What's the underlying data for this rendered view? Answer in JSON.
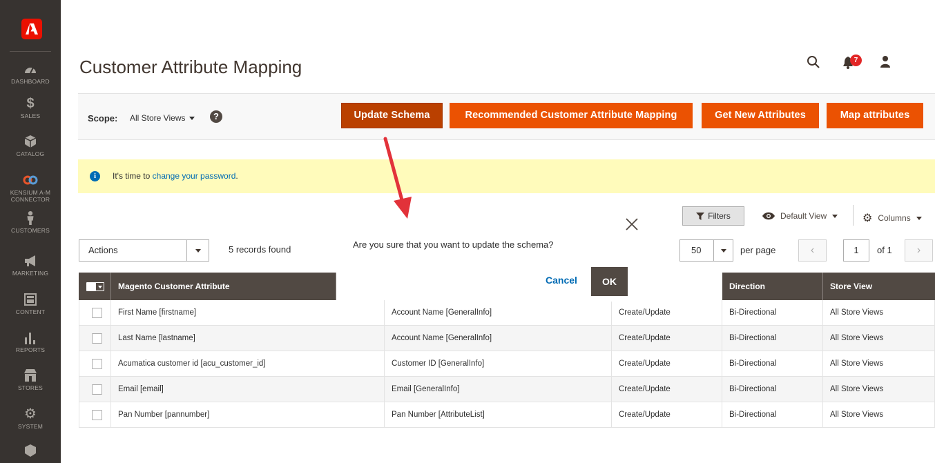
{
  "sidebar": {
    "items": [
      {
        "label": "DASHBOARD",
        "icon": "dashboard-icon"
      },
      {
        "label": "SALES",
        "icon": "dollar-icon"
      },
      {
        "label": "CATALOG",
        "icon": "box-icon"
      },
      {
        "label": "KENSIUM A-M CONNECTOR",
        "icon": "infinity-icon"
      },
      {
        "label": "CUSTOMERS",
        "icon": "person-icon"
      },
      {
        "label": "MARKETING",
        "icon": "megaphone-icon"
      },
      {
        "label": "CONTENT",
        "icon": "layout-icon"
      },
      {
        "label": "REPORTS",
        "icon": "bar-chart-icon"
      },
      {
        "label": "STORES",
        "icon": "store-icon"
      },
      {
        "label": "SYSTEM",
        "icon": "gear-icon"
      }
    ]
  },
  "header": {
    "title": "Customer Attribute Mapping",
    "notifications_count": "7"
  },
  "action_bar": {
    "scope_label": "Scope:",
    "scope_value": "All Store Views",
    "help_glyph": "?",
    "buttons": {
      "update_schema": "Update Schema",
      "recommended": "Recommended Customer Attribute Mapping",
      "get_new": "Get New Attributes",
      "map": "Map attributes"
    }
  },
  "notice": {
    "prefix": "It's time to ",
    "link": "change your password",
    "suffix": "."
  },
  "grid_toolbar": {
    "filters": "Filters",
    "view": "Default View",
    "columns": "Columns",
    "actions": "Actions",
    "records": "5 records found",
    "per_page_value": "50",
    "per_page_label": "per page",
    "page": "1",
    "page_of": "of 1"
  },
  "modal": {
    "message": "Are you sure that you want to update the schema?",
    "cancel": "Cancel",
    "ok": "OK"
  },
  "table": {
    "headers": [
      "Magento Customer Attribute",
      "",
      "",
      "Direction",
      "Store View"
    ],
    "rows": [
      {
        "magento": "First Name [firstname]",
        "acumatica": "Account Name [GeneralInfo]",
        "action": "Create/Update",
        "direction": "Bi-Directional",
        "store": "All Store Views"
      },
      {
        "magento": "Last Name [lastname]",
        "acumatica": "Account Name [GeneralInfo]",
        "action": "Create/Update",
        "direction": "Bi-Directional",
        "store": "All Store Views"
      },
      {
        "magento": "Acumatica customer id [acu_customer_id]",
        "acumatica": "Customer ID [GeneralInfo]",
        "action": "Create/Update",
        "direction": "Bi-Directional",
        "store": "All Store Views"
      },
      {
        "magento": "Email [email]",
        "acumatica": "Email [GeneralInfo]",
        "action": "Create/Update",
        "direction": "Bi-Directional",
        "store": "All Store Views"
      },
      {
        "magento": "Pan Number [pannumber]",
        "acumatica": "Pan Number [AttributeList]",
        "action": "Create/Update",
        "direction": "Bi-Directional",
        "store": "All Store Views"
      }
    ]
  },
  "colors": {
    "accent": "#eb5202",
    "accent_dark": "#ba4000",
    "sidebar": "#373330",
    "table_header": "#514943",
    "link": "#006bb4",
    "notice_bg": "#fffbbb"
  }
}
